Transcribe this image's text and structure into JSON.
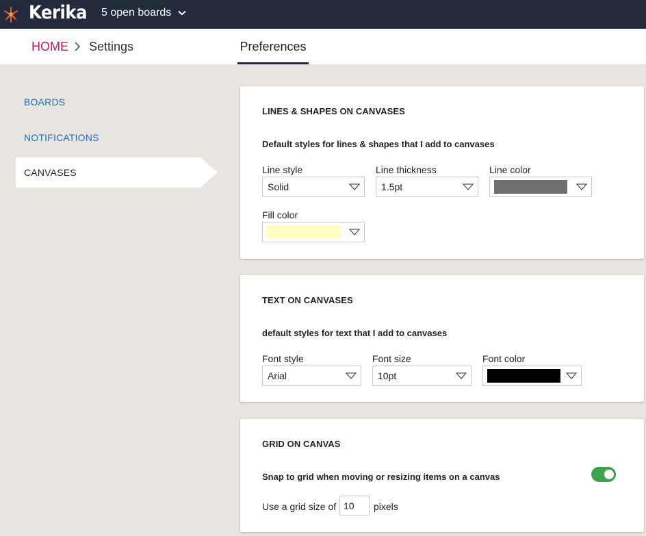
{
  "app": {
    "logo_text": "Kerika",
    "boards_switch_label": "5 open boards"
  },
  "breadcrumb": {
    "home": "HOME",
    "settings": "Settings"
  },
  "tab": {
    "preferences": "Preferences"
  },
  "sidebar": {
    "items": [
      {
        "label": "BOARDS"
      },
      {
        "label": "NOTIFICATIONS"
      },
      {
        "label": "CANVASES"
      }
    ]
  },
  "lines_card": {
    "title": "LINES & SHAPES ON CANVASES",
    "subtitle": "Default styles for lines & shapes that I add to canvases",
    "line_style": {
      "label": "Line style",
      "value": "Solid"
    },
    "line_thickness": {
      "label": "Line thickness",
      "value": "1.5pt"
    },
    "line_color": {
      "label": "Line color",
      "color": "#6e6e6e"
    },
    "fill_color": {
      "label": "Fill color",
      "color": "#ffffc2"
    }
  },
  "text_card": {
    "title": "TEXT ON CANVASES",
    "subtitle": "default styles for text that I add to canvases",
    "font_style": {
      "label": "Font style",
      "value": "Arial"
    },
    "font_size": {
      "label": "Font size",
      "value": "10pt"
    },
    "font_color": {
      "label": "Font color",
      "color": "#000000"
    }
  },
  "grid_card": {
    "title": "GRID ON CANVAS",
    "snap_label": "Snap to grid when moving or resizing items on a canvas",
    "snap_enabled": true,
    "grid_size_prefix": "Use a grid size of",
    "grid_size_value": "10",
    "grid_size_suffix": "pixels"
  },
  "colors": {
    "topbar": "#232a3c",
    "home_link": "#c2185b",
    "side_link": "#1e6cc4",
    "toggle_on": "#3fa34d"
  }
}
